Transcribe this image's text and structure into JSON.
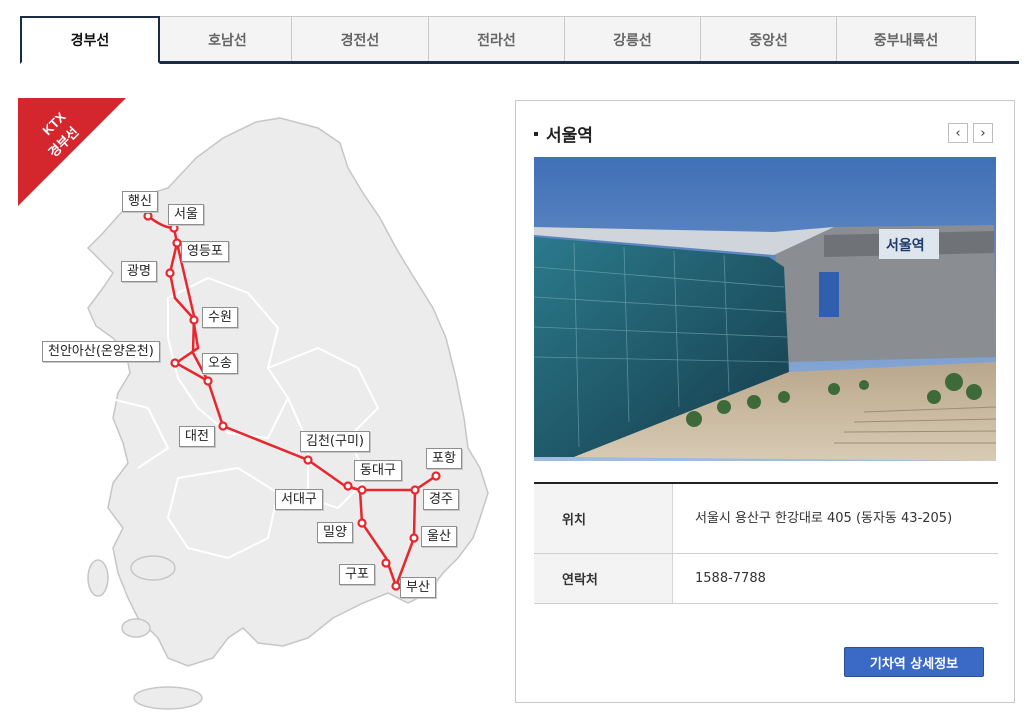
{
  "tabs": [
    {
      "label": "경부선",
      "active": true
    },
    {
      "label": "호남선",
      "active": false
    },
    {
      "label": "경전선",
      "active": false
    },
    {
      "label": "전라선",
      "active": false
    },
    {
      "label": "강릉선",
      "active": false
    },
    {
      "label": "중앙선",
      "active": false
    },
    {
      "label": "중부내륙선",
      "active": false
    }
  ],
  "map": {
    "ribbon_line1": "KTX",
    "ribbon_line2": "경부선",
    "route_color": "#e8262d",
    "stations": {
      "haengsin": "행신",
      "seoul": "서울",
      "yeongdeungpo": "영등포",
      "gwangmyeong": "광명",
      "suwon": "수원",
      "cheonanasan": "천안아산(온양온천)",
      "osong": "오송",
      "daejeon": "대전",
      "gimcheon": "김천(구미)",
      "dongdaegu": "동대구",
      "seodaegu": "서대구",
      "pohang": "포항",
      "gyeongju": "경주",
      "miryang": "밀양",
      "ulsan": "울산",
      "gupo": "구포",
      "busan": "부산"
    }
  },
  "station_info": {
    "title": "서울역",
    "prev_icon": "‹",
    "next_icon": "›",
    "photo_sign": "서울역",
    "location_label": "위치",
    "location_value": "서울시 용산구 한강대로 405 (동자동 43-205)",
    "contact_label": "연락처",
    "contact_value": "1588-7788",
    "detail_button": "기차역 상세정보"
  }
}
